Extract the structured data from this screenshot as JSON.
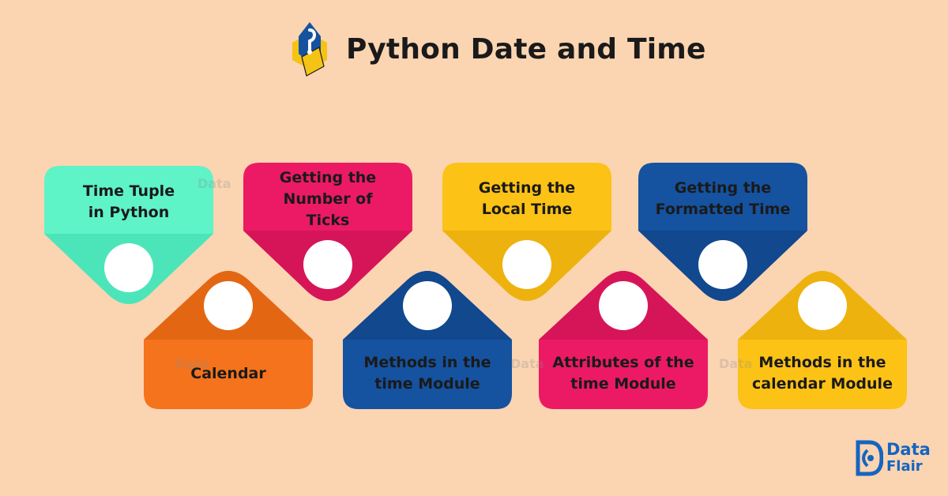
{
  "header": {
    "title": "Python Date and Time"
  },
  "cards": [
    {
      "id": "time-tuple",
      "lines": [
        "Time Tuple",
        "in Python"
      ],
      "color": "#5ff3c8",
      "shadow": "#3dd9ad"
    },
    {
      "id": "number-of-ticks",
      "lines": [
        "Getting the",
        "Number of",
        "Ticks"
      ],
      "color": "#ec1a64",
      "shadow": "#c4124f"
    },
    {
      "id": "local-time",
      "lines": [
        "Getting the",
        "Local Time"
      ],
      "color": "#fcc216",
      "shadow": "#e2a60a"
    },
    {
      "id": "formatted-time",
      "lines": [
        "Getting the",
        "Formatted Time"
      ],
      "color": "#1552a0",
      "shadow": "#0e3f80"
    },
    {
      "id": "calendar",
      "lines": [
        "Calendar"
      ],
      "color": "#f4731c",
      "shadow": "#d55c0d"
    },
    {
      "id": "time-methods",
      "lines": [
        "Methods in the",
        "time Module"
      ],
      "color": "#1552a0",
      "shadow": "#0e3f80"
    },
    {
      "id": "time-attributes",
      "lines": [
        "Attributes of the",
        "time Module"
      ],
      "color": "#ec1a64",
      "shadow": "#c4124f"
    },
    {
      "id": "calendar-methods",
      "lines": [
        "Methods in the",
        "calendar Module"
      ],
      "color": "#fcc216",
      "shadow": "#e2a60a"
    }
  ],
  "watermark": {
    "line1": "Data",
    "line2": "Flair"
  },
  "footer_logo": {
    "line1": "Data",
    "line2": "Flair",
    "color": "#1565c0"
  },
  "colors": {
    "background": "#fbd4b1",
    "title_text": "#1a1a1a",
    "circle": "#ffffff"
  }
}
